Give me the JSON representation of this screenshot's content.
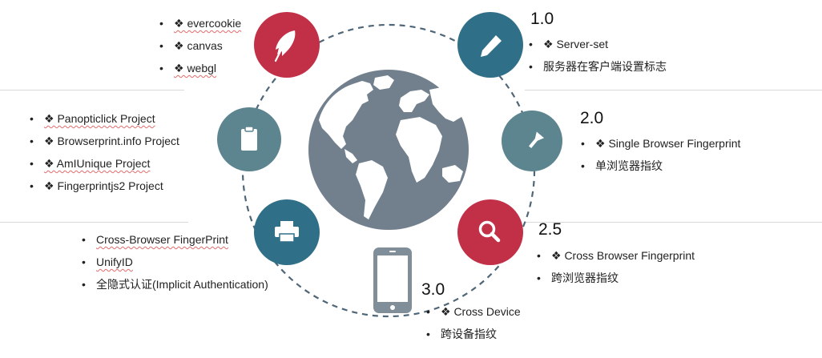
{
  "colors": {
    "red": "#c23048",
    "teal_dark": "#2f6f87",
    "teal_mid": "#5c8590",
    "globe": "#727f8d",
    "land": "#ffffff",
    "dash": "#4e6677",
    "phone": "#7f8e99"
  },
  "nodes": [
    {
      "id": "quill",
      "icon": "quill-icon",
      "color": "red"
    },
    {
      "id": "pencil",
      "icon": "pencil-icon",
      "color": "teal_dark"
    },
    {
      "id": "clipboard",
      "icon": "clipboard-icon",
      "color": "teal_mid"
    },
    {
      "id": "flashlight",
      "icon": "flashlight-icon",
      "color": "teal_mid"
    },
    {
      "id": "printer",
      "icon": "printer-icon",
      "color": "teal_dark"
    },
    {
      "id": "search",
      "icon": "search-icon",
      "color": "red"
    },
    {
      "id": "phone",
      "icon": "phone-icon",
      "color": "phone"
    }
  ],
  "groups": {
    "top_left": {
      "items": [
        "❖ evercookie",
        "❖ canvas",
        "❖ webgl"
      ]
    },
    "mid_left": {
      "items": [
        "❖ Panopticlick Project",
        "❖ Browserprint.info Project",
        "❖ AmIUnique Project",
        "❖ Fingerprintjs2 Project"
      ]
    },
    "bottom_left": {
      "items": [
        "Cross-Browser FingerPrint",
        "UnifyID",
        "全隐式认证(Implicit Authentication)"
      ]
    },
    "v1": {
      "version": "1.0",
      "items": [
        "❖ Server-set",
        "服务器在客户端设置标志"
      ]
    },
    "v2": {
      "version": "2.0",
      "items": [
        "❖ Single Browser Fingerprint",
        "单浏览器指纹"
      ]
    },
    "v25": {
      "version": "2.5",
      "items": [
        "❖ Cross Browser Fingerprint",
        "跨浏览器指纹"
      ]
    },
    "v3": {
      "version": "3.0",
      "items": [
        "❖ Cross Device",
        "跨设备指纹"
      ]
    }
  }
}
